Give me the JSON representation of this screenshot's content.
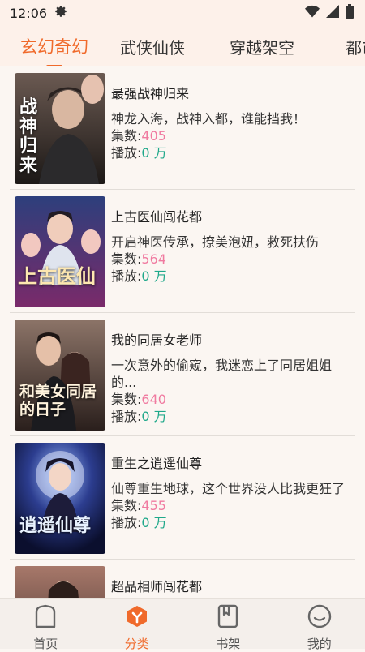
{
  "status": {
    "time": "12:06"
  },
  "tabs": [
    {
      "label": "玄幻奇幻",
      "active": true
    },
    {
      "label": "武侠仙侠",
      "active": false
    },
    {
      "label": "穿越架空",
      "active": false
    },
    {
      "label": "都市",
      "active": false
    }
  ],
  "items": [
    {
      "title": "最强战神归来",
      "desc": "神龙入海，战神入都，谁能挡我！",
      "count_label": "集数:",
      "count": "405",
      "plays_label": "播放:",
      "plays": "0 万",
      "cover_text": "战神归来"
    },
    {
      "title": "上古医仙闯花都",
      "desc": "开启神医传承，撩美泡妞，救死扶伤",
      "count_label": "集数:",
      "count": "564",
      "plays_label": "播放:",
      "plays": "0 万",
      "cover_text": "上古医仙"
    },
    {
      "title": "我的同居女老师",
      "desc": "一次意外的偷窥，我迷恋上了同居姐姐的...",
      "count_label": "集数:",
      "count": "640",
      "plays_label": "播放:",
      "plays": "0 万",
      "cover_text": "和美女同居的日子"
    },
    {
      "title": "重生之逍遥仙尊",
      "desc": "仙尊重生地球，这个世界没人比我更狂了",
      "count_label": "集数:",
      "count": "455",
      "plays_label": "播放:",
      "plays": "0 万",
      "cover_text": "逍遥仙尊"
    },
    {
      "title": "超品相师闯花都",
      "desc": "",
      "count_label": "",
      "count": "",
      "plays_label": "",
      "plays": "",
      "cover_text": ""
    }
  ],
  "nav": [
    {
      "label": "首页",
      "icon": "home-icon",
      "active": false
    },
    {
      "label": "分类",
      "icon": "category-icon",
      "active": true
    },
    {
      "label": "书架",
      "icon": "bookshelf-icon",
      "active": false
    },
    {
      "label": "我的",
      "icon": "profile-icon",
      "active": false
    }
  ],
  "colors": {
    "accent": "#f06a2b",
    "count": "#f07aa0",
    "plays": "#1fa88a"
  }
}
